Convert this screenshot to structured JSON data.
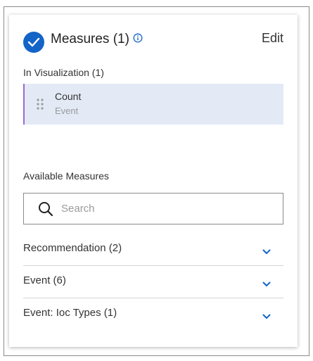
{
  "measures": {
    "title": "Measures (1)",
    "edit_label": "Edit"
  },
  "in_visualization": {
    "label": "In Visualization (1)",
    "items": [
      {
        "name": "Count",
        "source": "Event"
      }
    ]
  },
  "available": {
    "label": "Available Measures",
    "search_placeholder": "Search",
    "search_value": "",
    "groups": [
      {
        "label": "Recommendation (2)"
      },
      {
        "label": "Event (6)"
      },
      {
        "label": "Event: Ioc Types (1)"
      }
    ]
  },
  "icons": {
    "header": "check-circle-icon",
    "info": "info-icon",
    "drag": "drag-handle-icon",
    "search": "search-icon",
    "expand": "chevron-down-icon"
  },
  "colors": {
    "accent": "#1464c8",
    "selected_item_bg": "#e3eaf6",
    "selected_item_border": "#9b6bd0",
    "muted_text": "#9a9a9a"
  }
}
